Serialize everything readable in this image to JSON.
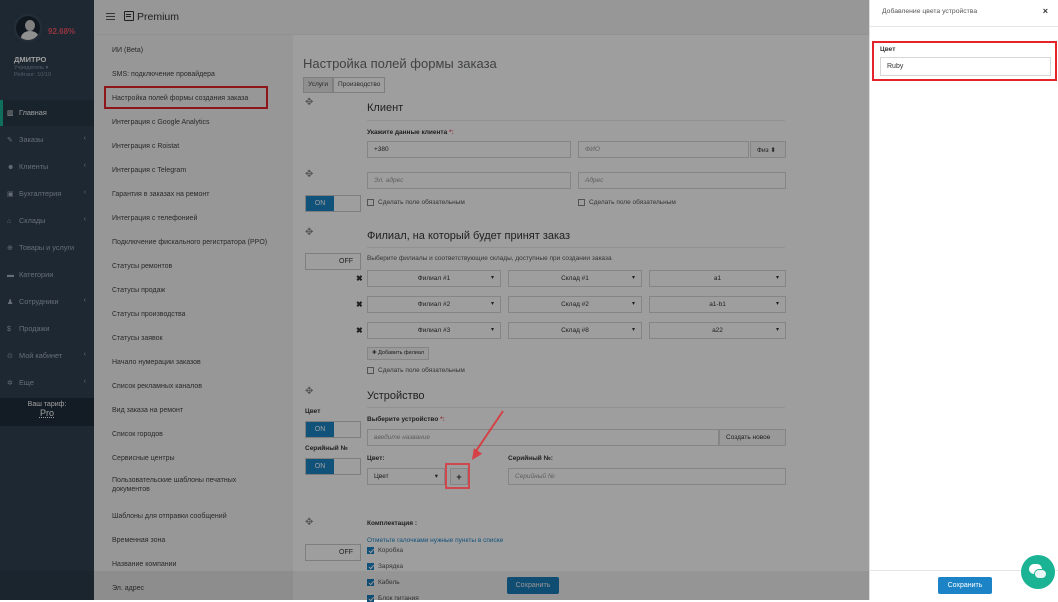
{
  "user": {
    "name": "ДМИТРО",
    "role": "Учредитель ▾",
    "rating": "Рейтинг: 10/10",
    "percent": "92.68%"
  },
  "nav": {
    "items": [
      {
        "icon": "▥",
        "label": "Главная",
        "active": true
      },
      {
        "icon": "✎",
        "label": "Заказы",
        "chevron": "‹"
      },
      {
        "icon": "☻",
        "label": "Клиенты",
        "chevron": "‹"
      },
      {
        "icon": "▣",
        "label": "Бухгалтерия",
        "chevron": "‹"
      },
      {
        "icon": "⌂",
        "label": "Склады",
        "chevron": "‹"
      },
      {
        "icon": "⊕",
        "label": "Товары и услуги"
      },
      {
        "icon": "▬",
        "label": "Категории"
      },
      {
        "icon": "♟",
        "label": "Сотрудники",
        "chevron": "‹"
      },
      {
        "icon": "$",
        "label": "Продажи"
      },
      {
        "icon": "⊙",
        "label": "Мой кабинет",
        "chevron": "‹"
      },
      {
        "icon": "✲",
        "label": "Еще",
        "chevron": "‹"
      }
    ],
    "tariff_label": "Ваш тариф:",
    "tariff_value": "Pro"
  },
  "header": {
    "brand": "Premium"
  },
  "settings_menu": [
    "ИИ (Beta)",
    "SMS: подключение провайдера",
    "Настройка полей формы создания заказа",
    "Интеграция с Google Analytics",
    "Интеграция с Roistat",
    "Интеграция с Telegram",
    "Гарантия в заказах на ремонт",
    "Интеграция с телефонией",
    "Подключение фискального регистратора (PPO)",
    "Статусы ремонтов",
    "Статусы продаж",
    "Статусы производства",
    "Статусы заявок",
    "Начало нумерации заказов",
    "Список рекламных каналов",
    "Вид заказа на ремонт",
    "Список городов",
    "Сервисные центры",
    "Пользовательские шаблоны печатных документов",
    "Шаблоны для отправки сообщений",
    "Временная зона",
    "Название компании",
    "Эл. адрес"
  ],
  "page": {
    "title": "Настройка полей формы заказа",
    "tabs": [
      "Услуги",
      "Производство"
    ],
    "client": {
      "section": "Клиент",
      "label": "Укажите данные клиента",
      "req": "*:",
      "phone": "+380",
      "fio_ph": "ФИО",
      "type": "Физ",
      "email_ph": "Эл. адрес",
      "address_ph": "Адрес",
      "required_label": "Сделать поле обязательным",
      "toggle_on": "ON"
    },
    "branch": {
      "section": "Филиал, на который будет принят заказ",
      "hint": "Выберите филиалы и соответствующие склады, доступные при создании заказа",
      "rows": [
        {
          "branch": "Филиал #1",
          "warehouse": "Склад #1",
          "cell": "a1"
        },
        {
          "branch": "Филиал #2",
          "warehouse": "Склад #2",
          "cell": "a1-b1"
        },
        {
          "branch": "Филиал #3",
          "warehouse": "Склад #8",
          "cell": "a22"
        }
      ],
      "add_label": "✚ Добавить филиал",
      "required_label": "Сделать поле обязательным",
      "toggle_off": "OFF"
    },
    "device": {
      "section": "Устройство",
      "color_side_label": "Цвет",
      "serial_side_label": "Серийный №",
      "toggle_on": "ON",
      "select_label": "Выберите устройство",
      "req": "*:",
      "input_ph": "введите название",
      "create_btn": "Создать новое",
      "color_label": "Цвет:",
      "color_value": "Цвет",
      "add_color": "+",
      "serial_label": "Серийный №:",
      "serial_ph": "Серийный №"
    },
    "kit": {
      "section": "Комплектация :",
      "hint": "Отметьте галочками нужные пункты в списке",
      "items": [
        "Коробка",
        "Зарядка",
        "Кабель",
        "Блок питания"
      ],
      "toggle_off": "OFF"
    },
    "save": "Сохранить"
  },
  "modal": {
    "title": "Добавление цвета устройства",
    "close": "×",
    "field_label": "Цвет",
    "field_value": "Ruby",
    "save": "Сохранить"
  },
  "colors": {
    "sidebar": "#2f4050",
    "accent": "#1c84c6",
    "active": "#1ab394",
    "highlight": "#e5232b"
  }
}
